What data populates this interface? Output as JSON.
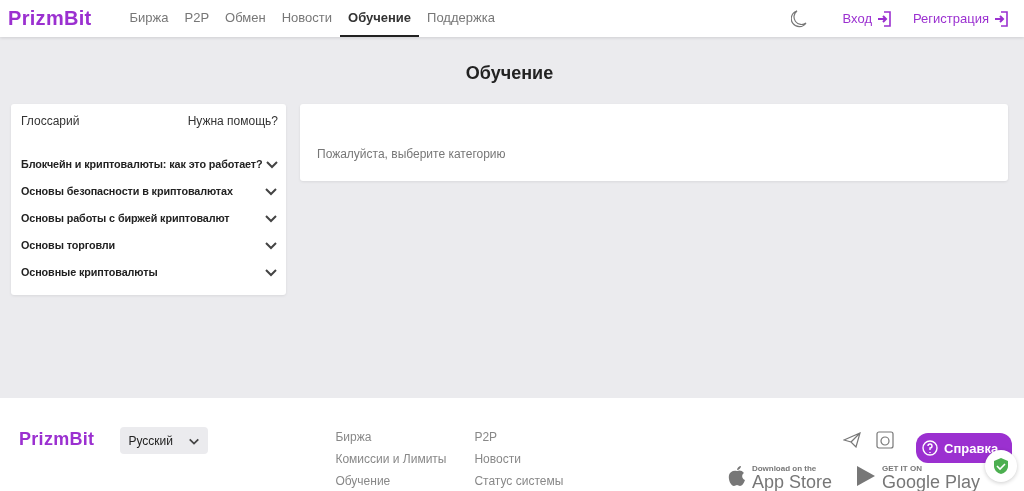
{
  "header": {
    "logo": "PrizmBit",
    "nav": [
      {
        "label": "Биржа",
        "selected": false
      },
      {
        "label": "P2P",
        "selected": false
      },
      {
        "label": "Обмен",
        "selected": false
      },
      {
        "label": "Новости",
        "selected": false
      },
      {
        "label": "Обучение",
        "selected": true
      },
      {
        "label": "Поддержка",
        "selected": false
      }
    ],
    "login": "Вход",
    "register": "Регистрация"
  },
  "page_title": "Обучение",
  "sidebar": {
    "glossary": "Глоссарий",
    "help": "Нужна помощь?",
    "categories": [
      {
        "label": "Блокчейн и криптовалюты: как это работает?"
      },
      {
        "label": "Основы безопасности в криптовалютах"
      },
      {
        "label": "Основы работы с биржей криптовалют"
      },
      {
        "label": "Основы торговли"
      },
      {
        "label": "Основные криптовалюты"
      }
    ]
  },
  "content": {
    "message": "Пожалуйста, выберите категорию"
  },
  "footer": {
    "logo": "PrizmBit",
    "language": "Русский",
    "links_col_1": [
      "Биржа",
      "Комиссии и Лимиты",
      "Обучение"
    ],
    "links_col_2": [
      "P2P",
      "Новости",
      "Статус системы"
    ],
    "app_store": {
      "small": "Download on the",
      "big": "App Store"
    },
    "google_play": {
      "small": "GET IT ON",
      "big": "Google Play"
    }
  },
  "help_button": "Справка"
}
